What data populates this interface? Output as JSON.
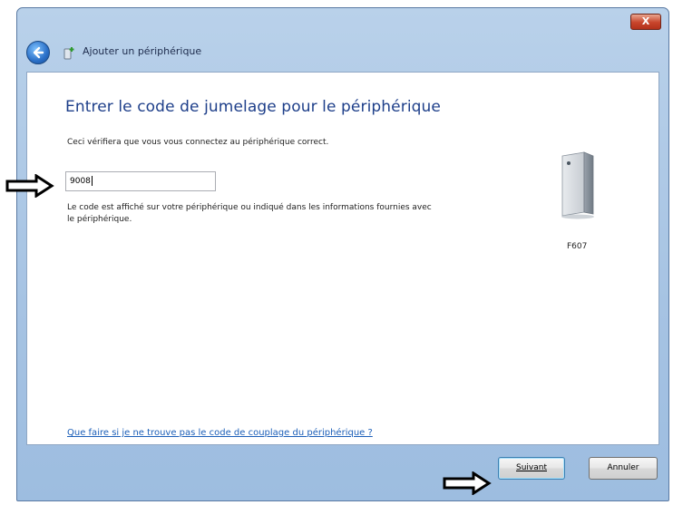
{
  "window": {
    "close_label": "X",
    "title": "Ajouter un périphérique"
  },
  "content": {
    "heading": "Entrer le code de jumelage pour le périphérique",
    "description": "Ceci vérifiera que vous vous connectez au périphérique correct.",
    "code_input": {
      "value": "9008",
      "placeholder": ""
    },
    "hint": "Le code est affiché sur votre périphérique ou indiqué dans les informations fournies avec le périphérique.",
    "device": {
      "name": "F607",
      "icon": "device-tower-icon"
    },
    "help_link": "Que faire si je ne trouve pas le code de couplage du périphérique ?"
  },
  "footer": {
    "next_label": "Suivant",
    "cancel_label": "Annuler"
  },
  "annotations": {
    "arrow_color": "#000000"
  }
}
